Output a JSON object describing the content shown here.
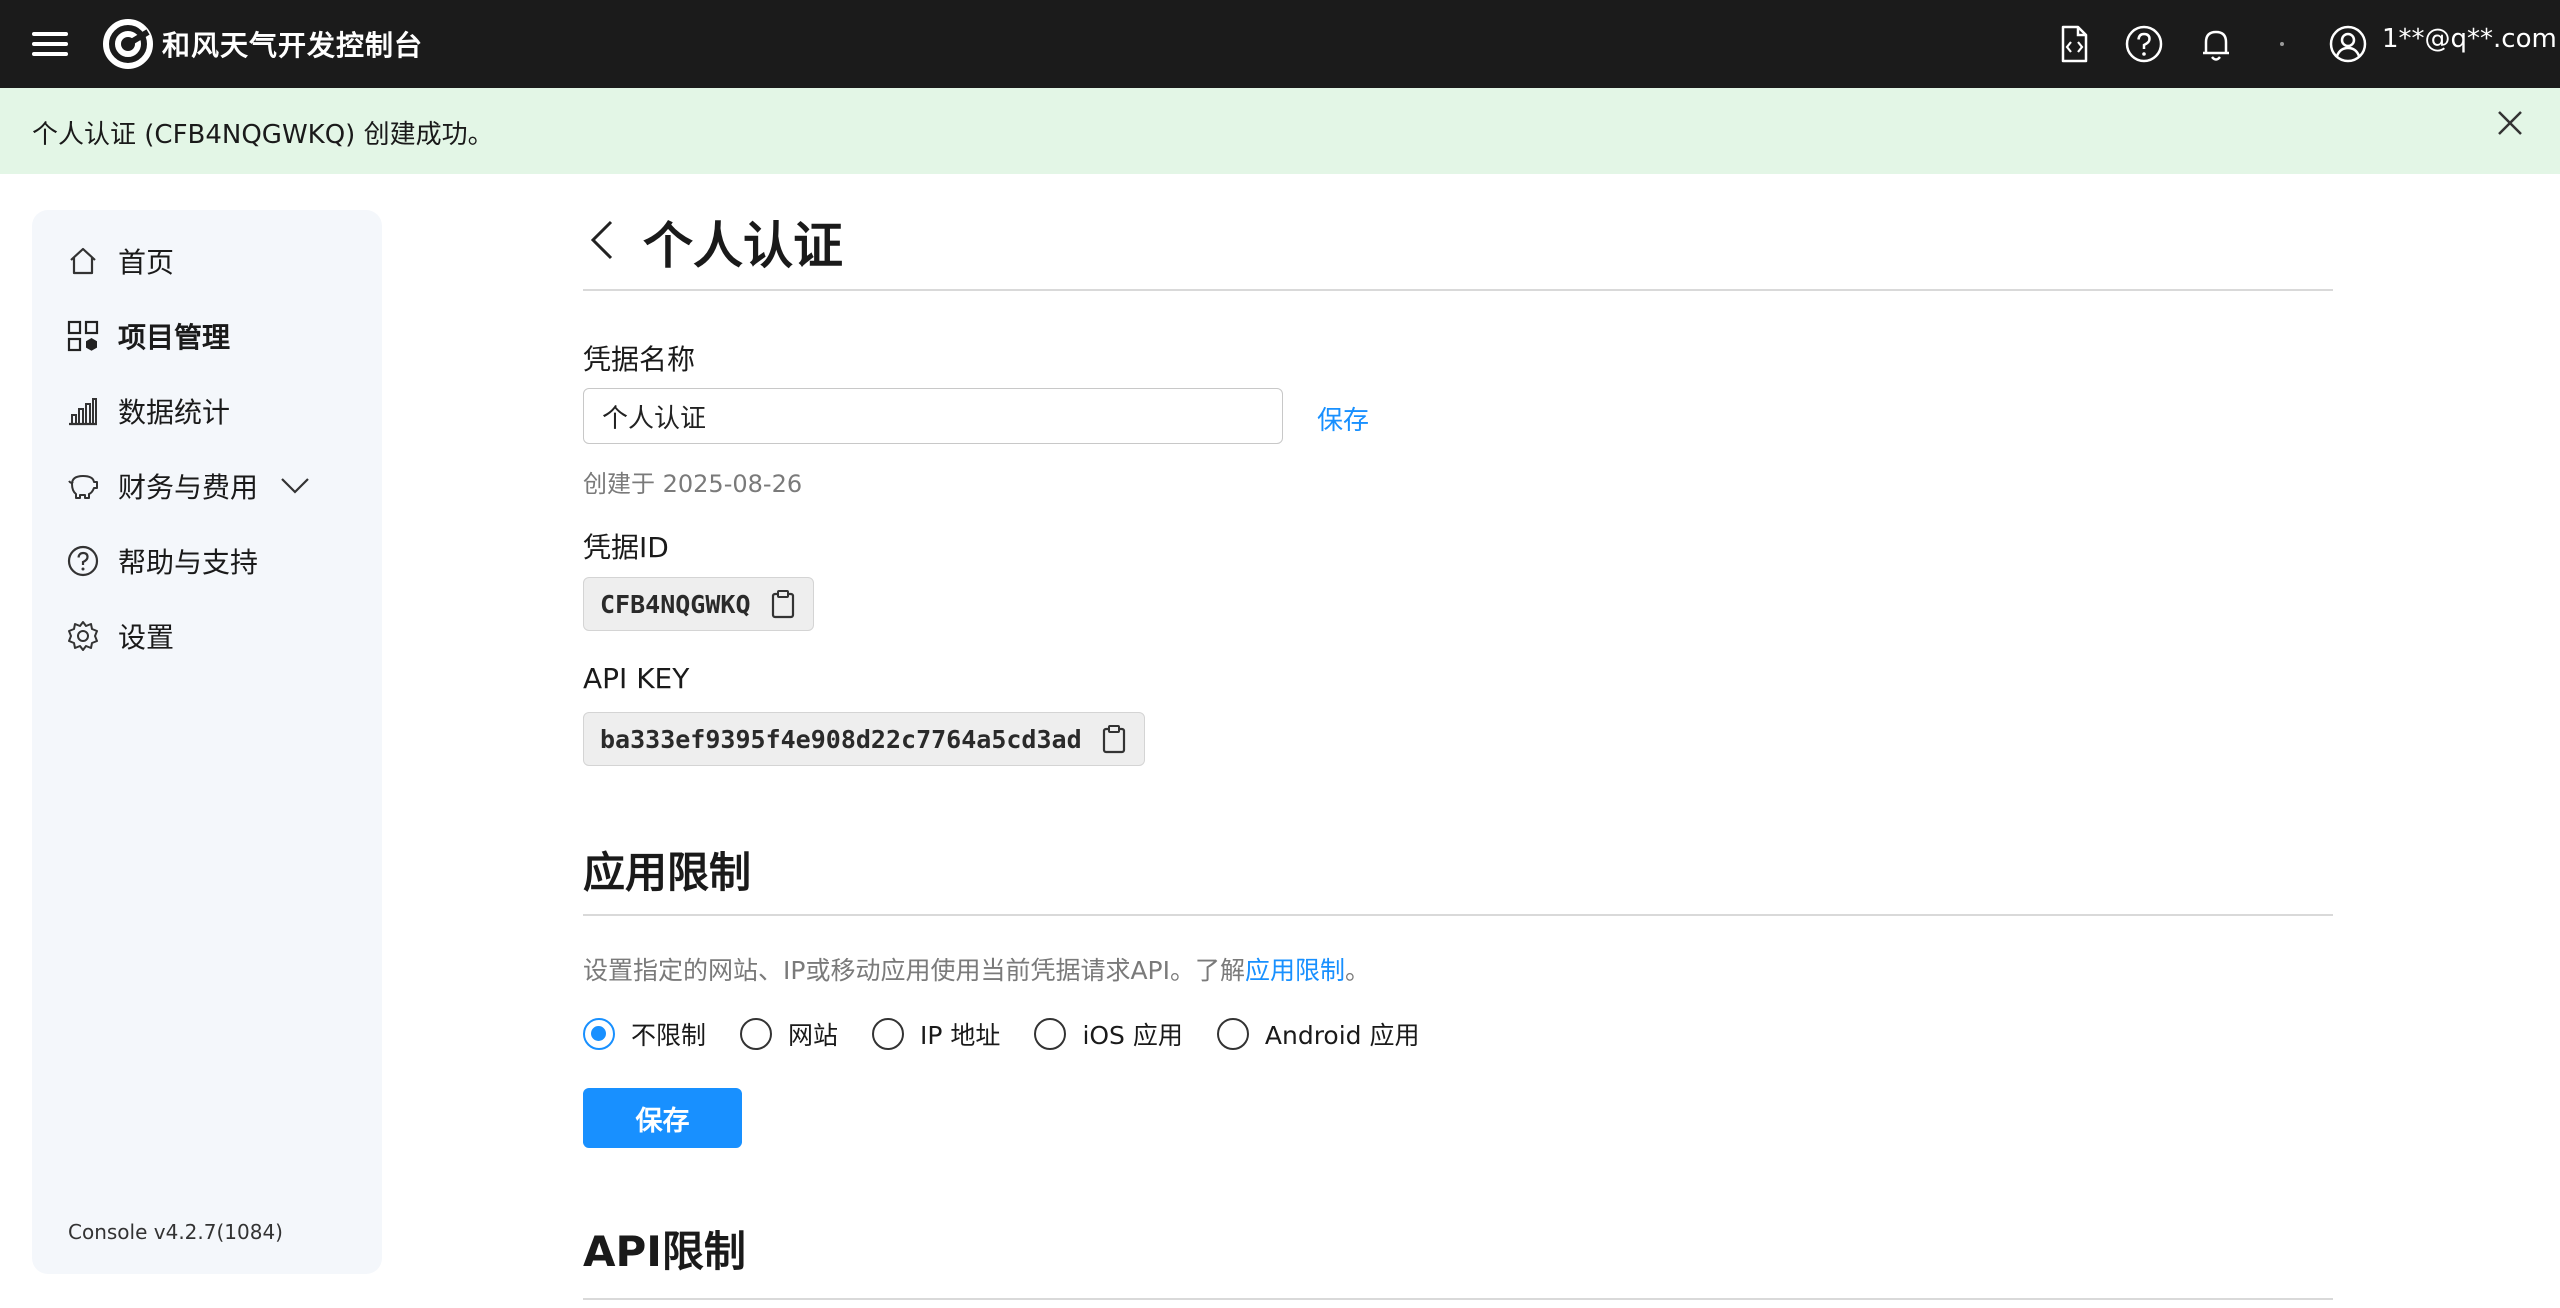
{
  "header": {
    "title": "和风天气开发控制台",
    "user_email": "1**@q**.com",
    "icons": [
      "menu-icon",
      "logo-icon",
      "code-doc-icon",
      "help-icon",
      "bell-icon",
      "dot-icon",
      "user-icon"
    ]
  },
  "alert": {
    "message": "个人认证 (CFB4NQGWKQ) 创建成功。",
    "color": "#e3f6e6"
  },
  "sidebar": {
    "items": [
      {
        "label": "首页",
        "icon": "home-icon"
      },
      {
        "label": "项目管理",
        "icon": "grid-icon",
        "active": true
      },
      {
        "label": "数据统计",
        "icon": "bar-chart-icon"
      },
      {
        "label": "财务与费用",
        "icon": "piggy-bank-icon",
        "expandable": true
      },
      {
        "label": "帮助与支持",
        "icon": "help-circle-icon"
      },
      {
        "label": "设置",
        "icon": "gear-icon"
      }
    ],
    "version": "Console v4.2.7(1084)"
  },
  "main": {
    "title": "个人认证",
    "credential_name_label": "凭据名称",
    "credential_name_value": "个人认证",
    "save_link": "保存",
    "created_text": "创建于 2025-08-26",
    "credential_id_label": "凭据ID",
    "credential_id": "CFB4NQGWKQ",
    "api_key_label": "API KEY",
    "api_key": "ba333ef9395f4e908d22c7764a5cd3ad",
    "app_limit": {
      "title": "应用限制",
      "desc_prefix": "设置指定的网站、IP或移动应用使用当前凭据请求API。了解",
      "desc_link": "应用限制",
      "desc_suffix": "。",
      "options": [
        "不限制",
        "网站",
        "IP 地址",
        "iOS 应用",
        "Android 应用"
      ],
      "selected": "不限制",
      "save_button": "保存"
    },
    "api_limit": {
      "title": "API限制"
    }
  },
  "colors": {
    "accent": "#1890ff",
    "topbar": "#1b1b1b",
    "sidebar_bg": "#f4f7fb"
  }
}
